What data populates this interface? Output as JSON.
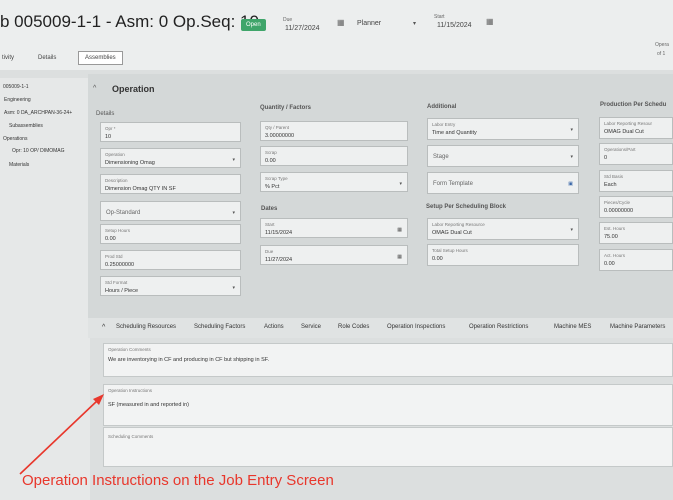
{
  "header": {
    "title": "b 005009-1-1 - Asm: 0 Op.Seq: 10",
    "status": "Open",
    "due_label": "Due",
    "due_value": "11/27/2024",
    "planner_label": "Planner",
    "start_label": "Start",
    "start_value": "11/15/2024",
    "ops_label": "Opera",
    "ops_value": "of 1"
  },
  "top_tabs": [
    "tivity",
    "Details",
    "Assemblies"
  ],
  "tree": {
    "items": [
      "005009-1-1",
      "Engineering",
      "Asm: 0 DA_ARCHPAN-36-24+",
      "Subassemblies",
      "Operations",
      "Opr: 10 OP/ DIMOMAG",
      "Materials"
    ]
  },
  "operation": {
    "section_title": "Operation",
    "columns": {
      "details": "Details",
      "qty": "Quantity / Factors",
      "additional": "Additional",
      "production": "Production Per Schedu"
    },
    "details_fields": {
      "opr": {
        "label": "Opr *",
        "value": "10"
      },
      "operation": {
        "label": "Operation",
        "value": "Dimensioning Omag"
      },
      "description": {
        "label": "Description",
        "value": "Dimension Omag    QTY IN SF"
      },
      "op_standard": "Op-Standard",
      "setup_hours": {
        "label": "Setup Hours",
        "value": "0.00"
      },
      "prod_std": {
        "label": "Prod Std",
        "value": "0.25000000"
      },
      "std_format": {
        "label": "Std Format",
        "value": "Hours / Piece"
      }
    },
    "qty_fields": {
      "qty_parent": {
        "label": "Qty / Parent",
        "value": "3.00000000"
      },
      "scrap": {
        "label": "Scrap",
        "value": "0.00"
      },
      "scrap_type": {
        "label": "Scrap Type",
        "value": "% Pct"
      }
    },
    "dates": {
      "header": "Dates",
      "start": {
        "label": "Start",
        "value": "11/15/2024"
      },
      "due": {
        "label": "Due",
        "value": "11/27/2024"
      }
    },
    "additional_fields": {
      "labor_entry": {
        "label": "Labor Entry",
        "value": "Time and Quantity"
      },
      "stage": "Stage",
      "form_template": "Form Template"
    },
    "setup_block": {
      "header": "Setup Per Scheduling Block",
      "resource": {
        "label": "Labor Reporting Resource",
        "value": "OMAG Dual Cut"
      },
      "total_setup": {
        "label": "Total Setup Hours",
        "value": "0.00"
      }
    },
    "production_fields": {
      "resource": {
        "label": "Labor Reporting Resour",
        "value": "OMAG Dual Cut"
      },
      "ops_part": {
        "label": "Operations/Part",
        "value": "0"
      },
      "std_basis": {
        "label": "Std Basis",
        "value": "Each"
      },
      "pieces_cycle": {
        "label": "Pieces/Cycle",
        "value": "0.00000000"
      },
      "est_hours": {
        "label": "Est. Hours",
        "value": "75.00"
      },
      "act_hours": {
        "label": "Act. Hours",
        "value": "0.00"
      }
    }
  },
  "bottom_tabs": [
    "Scheduling Resources",
    "Scheduling Factors",
    "Actions",
    "Service",
    "Role Codes",
    "Operation Inspections",
    "Operation Restrictions",
    "Machine MES",
    "Machine Parameters"
  ],
  "comments": {
    "op_comments": {
      "label": "Operation Comments",
      "value": "We are inventorying in CF and producing in CF but shipping in SF."
    },
    "op_instructions": {
      "label": "Operation Instructions",
      "value": "SF (measured in and reported in)"
    },
    "sched_comments": {
      "label": "Scheduling Comments",
      "value": ""
    }
  },
  "annotation": {
    "caption": "Operation Instructions on the Job Entry Screen",
    "color": "#e8372c"
  }
}
